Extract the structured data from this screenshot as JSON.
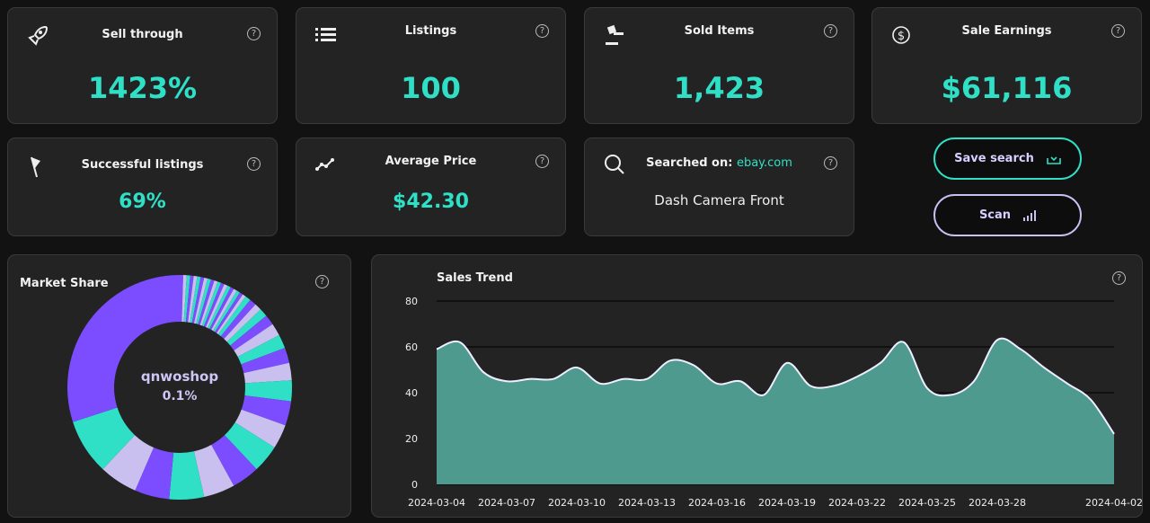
{
  "cards": [
    {
      "title": "Sell through",
      "value": "1423%",
      "icon": "rocket-icon"
    },
    {
      "title": "Listings",
      "value": "100",
      "icon": "list-icon"
    },
    {
      "title": "Sold Items",
      "value": "1,423",
      "icon": "gavel-icon"
    },
    {
      "title": "Sale Earnings",
      "value": "$61,116",
      "icon": "dollar-circle-icon"
    },
    {
      "title": "Successful listings",
      "value": "69%",
      "icon": "flag-icon"
    },
    {
      "title": "Average Price",
      "value": "$42.30",
      "icon": "trend-line-icon"
    }
  ],
  "search": {
    "label": "Searched on:",
    "site": "ebay.com",
    "query": "Dash Camera Front"
  },
  "buttons": {
    "save": "Save search",
    "scan": "Scan"
  },
  "help_glyph": "?",
  "colors": {
    "accent": "#2fe0c7",
    "purple": "#7b4dff",
    "lavender": "#c9c0f0",
    "area": "#4f9a8f"
  },
  "market_share": {
    "title": "Market Share",
    "center_label": "qnwoshop",
    "center_value": "0.1%",
    "slices": [
      0.5,
      0.5,
      0.5,
      0.5,
      0.5,
      0.5,
      0.5,
      0.5,
      0.5,
      0.5,
      0.5,
      0.5,
      0.5,
      0.5,
      0.5,
      0.5,
      0.5,
      0.5,
      0.5,
      0.5,
      0.8,
      1,
      1,
      1.2,
      1.5,
      1.8,
      2,
      2.2,
      2.5,
      3,
      3.5,
      3.5,
      4,
      4,
      4.5,
      5,
      5,
      5.5,
      8,
      30
    ]
  },
  "chart_data": {
    "type": "area",
    "title": "Sales Trend",
    "ylim": [
      0,
      80
    ],
    "yticks": [
      0,
      20,
      40,
      60,
      80
    ],
    "xtick_labels": [
      "2024-03-04",
      "2024-03-07",
      "2024-03-10",
      "2024-03-13",
      "2024-03-16",
      "2024-03-19",
      "2024-03-22",
      "2024-03-25",
      "2024-03-28",
      "2024-04-02"
    ],
    "x_start": "2024-03-04",
    "x_end": "2024-04-02",
    "values": [
      59,
      62,
      49,
      45,
      46,
      46,
      51,
      44,
      46,
      46,
      54,
      52,
      44,
      45,
      39,
      53,
      43,
      43,
      47,
      53,
      62,
      42,
      39,
      45,
      63,
      59,
      51,
      44,
      37,
      22
    ],
    "grid": true
  }
}
